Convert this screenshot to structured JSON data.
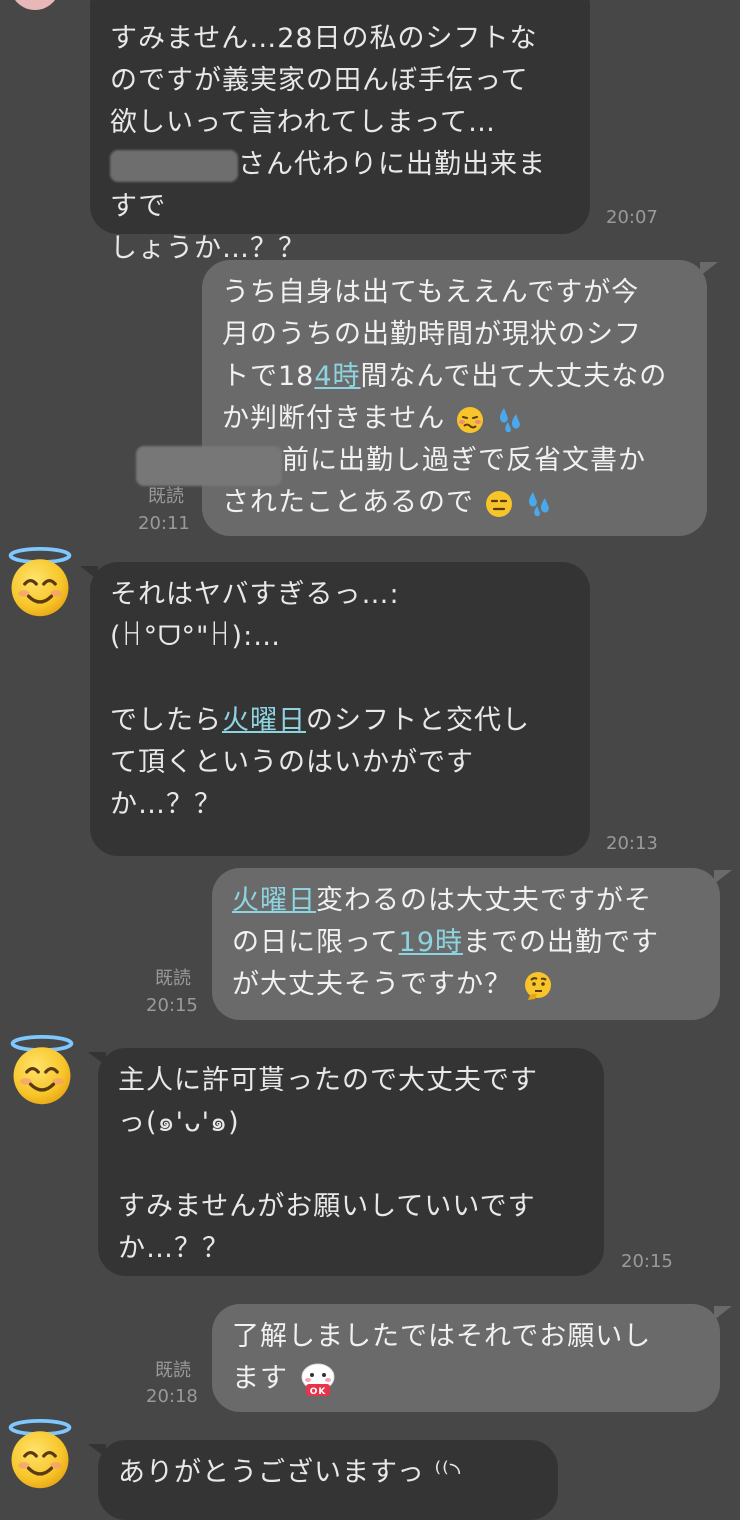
{
  "messages": [
    {
      "lines": [
        "すみません…28日の私のシフトな",
        "のですが義実家の田んぼ手伝って",
        "欲しいって言われてしまって…",
        "さん代わりに出勤出来ますで",
        "しょうか…？？"
      ],
      "time": "20:07"
    },
    {
      "lines": [
        "うち自身は出てもええんですが今",
        "月のうちの出勤時間が現状のシフ",
        "トで18",
        "4時",
        "間なんで出て大丈夫なの",
        "か判断付きません",
        "前に出勤し過ぎで反省文書か",
        "されたことあるので"
      ],
      "read": "既読",
      "time": "20:11"
    },
    {
      "lines": [
        "それはヤバすぎるっ…:(ꀿ°ᗜ°\"ꀿ):…",
        "",
        "でしたら",
        "火曜日",
        "のシフトと交代し",
        "て頂くというのはいかがです",
        "か…？？"
      ],
      "time": "20:13"
    },
    {
      "lines": [
        "火曜日",
        "変わるのは大丈夫ですがそ",
        "の日に限って",
        "19時",
        "までの出勤です",
        "が大丈夫そうですか？"
      ],
      "read": "既読",
      "time": "20:15"
    },
    {
      "lines": [
        "主人に許可貰ったので大丈夫です",
        "っ(๑'ᴗ'๑)",
        "",
        "すみませんがお願いしていいです",
        "か…？？"
      ],
      "time": "20:15"
    },
    {
      "lines": [
        "了解しましたではそれでお願いし",
        "ます"
      ],
      "read": "既読",
      "time": "20:18"
    },
    {
      "lines": [
        "ありがとうございますっ ⁽⁽◝"
      ]
    }
  ],
  "icons": {
    "avatar": "smiling-face-with-halo-icon",
    "woozy": "woozy-face-icon",
    "sweat": "sweat-droplets-icon",
    "neutral": "expressionless-face-icon",
    "thinking": "thinking-face-icon",
    "ok_sticker": "ok-sticker-icon"
  },
  "colors": {
    "background": "#474747",
    "incoming_bubble": "#343434",
    "outgoing_bubble": "#6a6a6a",
    "link": "#8ed3e0",
    "meta_text": "#9a9a9a"
  }
}
